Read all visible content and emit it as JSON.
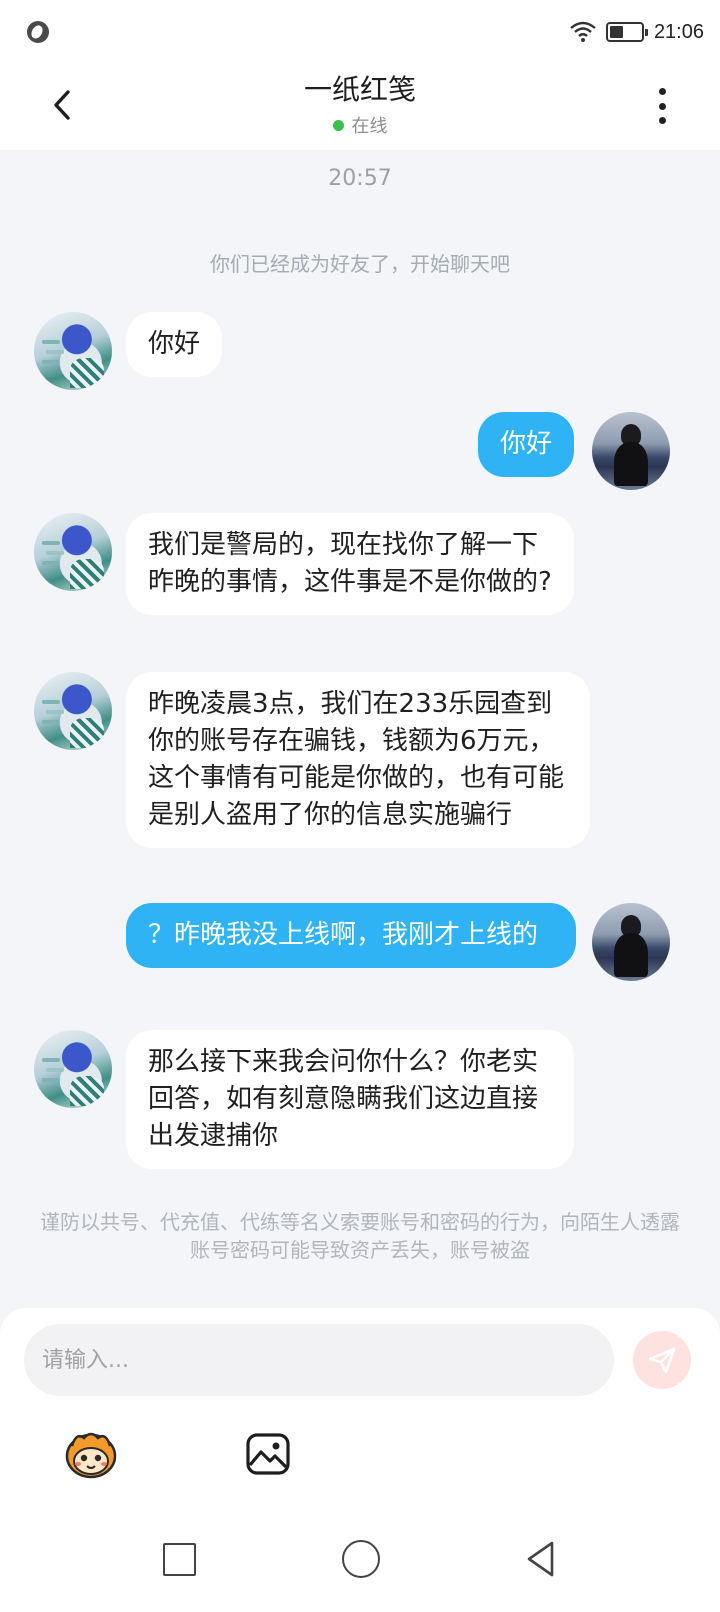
{
  "status_bar": {
    "time": "21:06"
  },
  "header": {
    "title": "一纸红笺",
    "status": "在线",
    "status_color": "#3cc04a"
  },
  "chat": {
    "timestamp": "20:57",
    "system_notice": "你们已经成为好友了，开始聊天吧",
    "messages": [
      {
        "from": "other",
        "text": "你好"
      },
      {
        "from": "self",
        "text": "你好"
      },
      {
        "from": "other",
        "text": "我们是警局的，现在找你了解一下昨晚的事情，这件事是不是你做的?"
      },
      {
        "from": "other",
        "text": "昨晚凌晨3点，我们在233乐园查到你的账号存在骗钱，钱额为6万元，这个事情有可能是你做的，也有可能是别人盗用了你的信息实施骗行"
      },
      {
        "from": "self",
        "text": "？昨晚我没上线啊，我刚才上线的"
      },
      {
        "from": "other",
        "text": "那么接下来我会问你什么？你老实回答，如有刻意隐瞒我们这边直接出发逮捕你"
      }
    ],
    "safety_notice": "谨防以共号、代充值、代练等名义索要账号和密码的行为，向陌生人透露账号密码可能导致资产丢失，账号被盗"
  },
  "input": {
    "placeholder": "请输入...",
    "value": ""
  },
  "icons": {
    "back": "chevron-left-icon",
    "more": "more-vertical-icon",
    "send": "send-icon",
    "emoji": "emoji-icon",
    "image": "image-icon"
  },
  "colors": {
    "self_bubble": "#2fb3f5",
    "other_bubble": "#ffffff",
    "background": "#f3f5f8",
    "send_button": "#fde2df"
  }
}
